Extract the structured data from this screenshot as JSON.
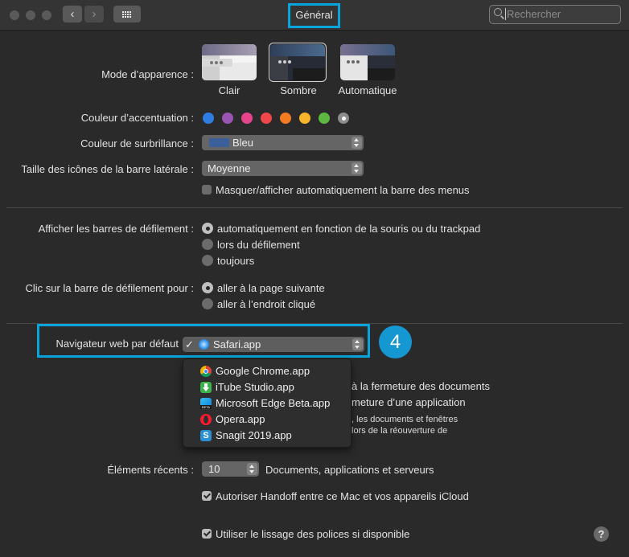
{
  "window": {
    "title": "Général"
  },
  "search": {
    "placeholder": "Rechercher"
  },
  "appearance": {
    "label": "Mode d’apparence :",
    "options": [
      "Clair",
      "Sombre",
      "Automatique"
    ],
    "selected": "Sombre"
  },
  "accent": {
    "label": "Couleur d’accentuation :",
    "colors": [
      "#2f7de1",
      "#9a55b2",
      "#e6458e",
      "#f0474b",
      "#f37b22",
      "#f7b52c",
      "#5cb840",
      "#8c8c8c"
    ],
    "selected_index": 7
  },
  "highlight": {
    "label": "Couleur de surbrillance :",
    "value": "Bleu",
    "swatch": "#3b5f9a"
  },
  "sidebar_icons": {
    "label": "Taille des icônes de la barre latérale :",
    "value": "Moyenne"
  },
  "menubar": {
    "label": "Masquer/afficher automatiquement la barre des menus",
    "checked": false
  },
  "scrollbars": {
    "label": "Afficher les barres de défilement :",
    "options": [
      "automatiquement en fonction de la souris ou du trackpad",
      "lors du défilement",
      "toujours"
    ],
    "selected_index": 0
  },
  "scroll_click": {
    "label": "Clic sur la barre de défilement pour :",
    "options": [
      "aller à la page suivante",
      "aller à l’endroit cliqué"
    ],
    "selected_index": 0
  },
  "browser": {
    "label": "Navigateur web par défaut",
    "value": "Safari.app",
    "check": "✓",
    "step_badge": "4",
    "menu": [
      {
        "label": "Google Chrome.app",
        "icon": "chrome-icon"
      },
      {
        "label": "iTube Studio.app",
        "icon": "itube-icon"
      },
      {
        "label": "Microsoft Edge Beta.app",
        "icon": "edge-beta-icon"
      },
      {
        "label": "Opera.app",
        "icon": "opera-icon"
      },
      {
        "label": "Snagit 2019.app",
        "icon": "snagit-icon"
      }
    ]
  },
  "hidden_behind_menu": {
    "line1": "à la fermeture des documents",
    "line2": "meture d’une application",
    "line3": ", les documents et fenêtres",
    "line4": "lors de la réouverture de"
  },
  "recent": {
    "label": "Éléments récents :",
    "value": "10",
    "suffix": "Documents, applications et serveurs"
  },
  "handoff": {
    "label": "Autoriser Handoff entre ce Mac et vos appareils iCloud",
    "checked": true
  },
  "font_smoothing": {
    "label": "Utiliser le lissage des polices si disponible",
    "checked": true
  },
  "help": {
    "label": "?"
  }
}
